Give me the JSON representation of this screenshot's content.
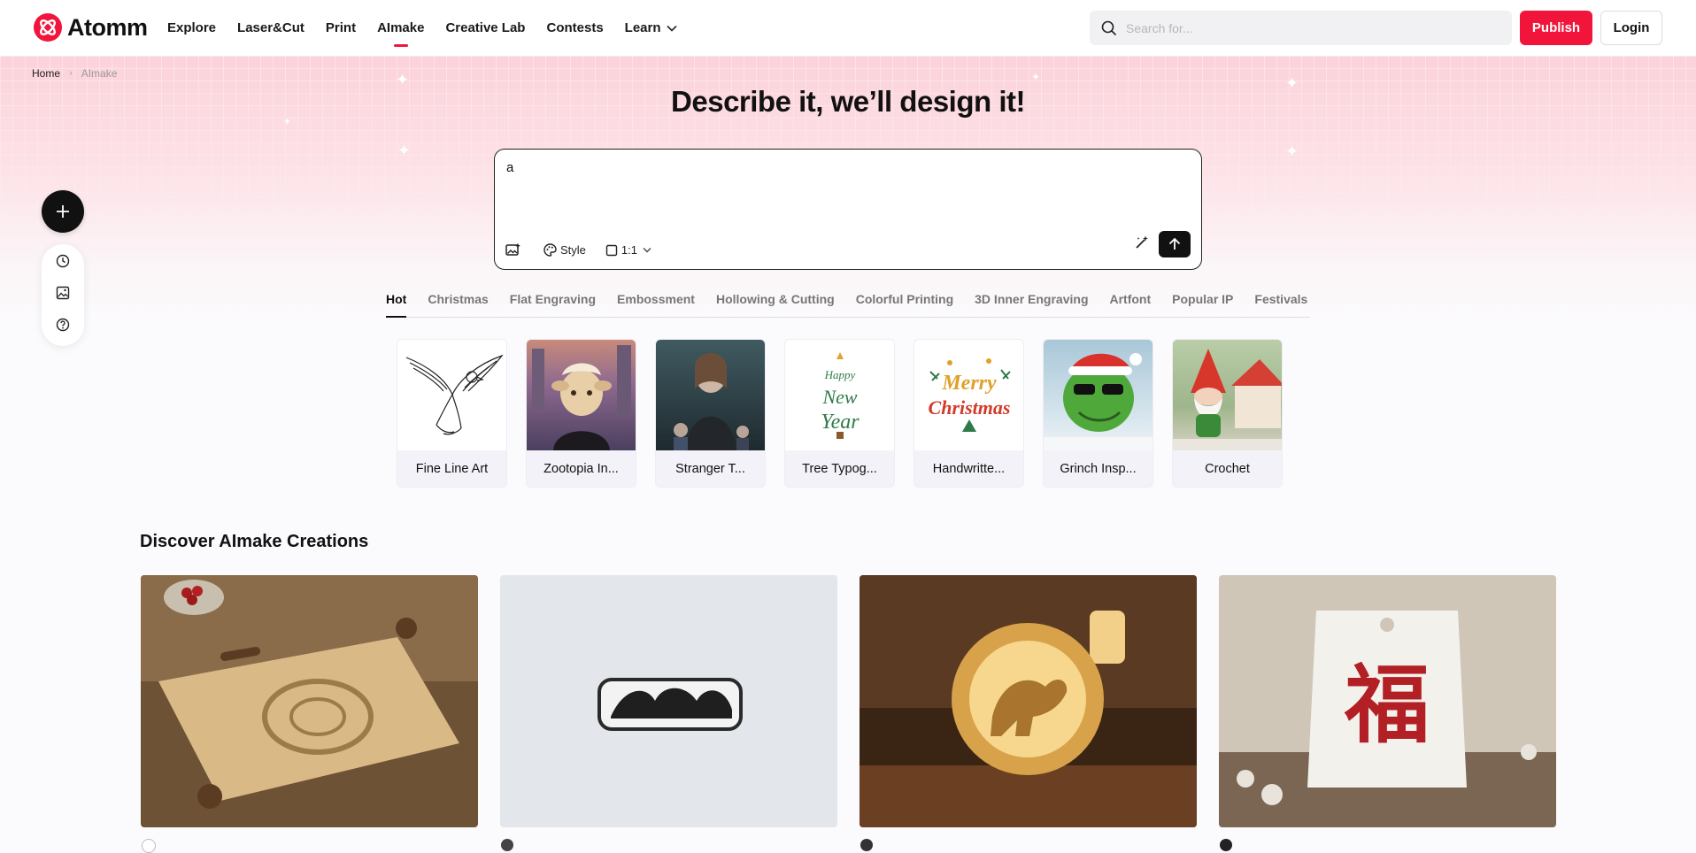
{
  "brand": {
    "name": "Atomm",
    "accent": "#f2153b"
  },
  "nav": {
    "items": [
      {
        "label": "Explore"
      },
      {
        "label": "Laser&Cut"
      },
      {
        "label": "Print"
      },
      {
        "label": "AImake"
      },
      {
        "label": "Creative Lab"
      },
      {
        "label": "Contests"
      },
      {
        "label": "Learn"
      }
    ],
    "active": "AImake"
  },
  "search": {
    "placeholder": "Search for..."
  },
  "header_actions": {
    "publish": "Publish",
    "login": "Login"
  },
  "breadcrumb": {
    "home": "Home",
    "current": "AImake"
  },
  "hero": {
    "title": "Describe it, we’ll design it!"
  },
  "prompt": {
    "value": "a",
    "style_label": "Style",
    "ratio_label": "1:1"
  },
  "tabs": [
    "Hot",
    "Christmas",
    "Flat Engraving",
    "Embossment",
    "Hollowing & Cutting",
    "Colorful Printing",
    "3D Inner Engraving",
    "Artfont",
    "Popular IP",
    "Festivals"
  ],
  "active_tab": "Hot",
  "styles": [
    {
      "label": "Fine Line Art",
      "icon": "eagle-line-art-image"
    },
    {
      "label": "Zootopia In...",
      "icon": "zootopia-character-image"
    },
    {
      "label": "Stranger T...",
      "icon": "stranger-things-image"
    },
    {
      "label": "Tree Typog...",
      "icon": "happy-new-year-tree-image"
    },
    {
      "label": "Handwritte...",
      "icon": "merry-christmas-lettering-image"
    },
    {
      "label": "Grinch Insp...",
      "icon": "grinch-image"
    },
    {
      "label": "Crochet",
      "icon": "crochet-gnome-image"
    }
  ],
  "discover": {
    "title": "Discover AImake Creations",
    "items": [
      {
        "icon": "engraved-cutting-board-image"
      },
      {
        "icon": "horse-keychain-image"
      },
      {
        "icon": "golden-horse-lamp-image"
      },
      {
        "icon": "fu-tag-image"
      }
    ]
  }
}
